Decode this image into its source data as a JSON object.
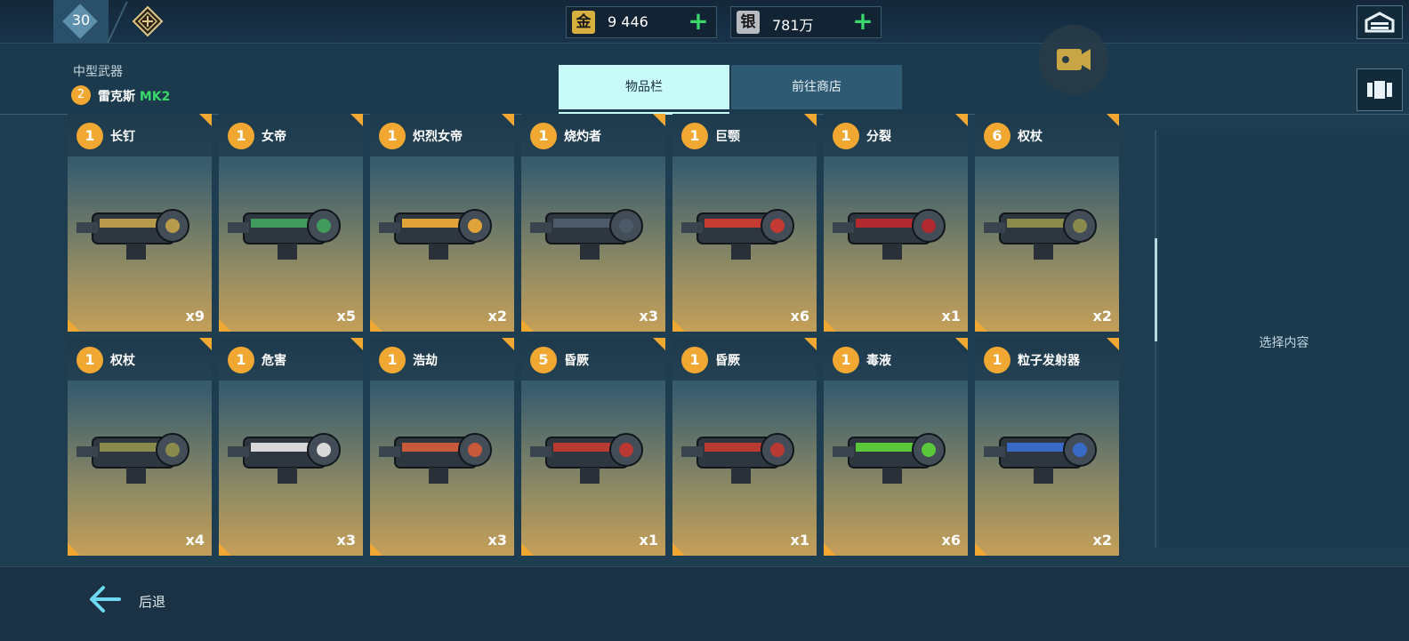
{
  "top": {
    "level": "30",
    "gold": {
      "icon_char": "金",
      "value": "9 446",
      "plus": "+"
    },
    "silver": {
      "icon_char": "银",
      "value": "781万",
      "plus": "+"
    }
  },
  "header": {
    "category": "中型武器",
    "selected": {
      "level": "2",
      "name": "雷克斯",
      "mark": "MK2"
    }
  },
  "tabs": [
    {
      "label": "物品栏",
      "active": true
    },
    {
      "label": "前往商店",
      "active": false
    }
  ],
  "items": [
    {
      "level": "1",
      "name": "长钉",
      "count": "x9",
      "color": "#b89a4c"
    },
    {
      "level": "1",
      "name": "女帝",
      "count": "x5",
      "color": "#3f9a5c"
    },
    {
      "level": "1",
      "name": "炽烈女帝",
      "count": "x2",
      "color": "#e0a43a"
    },
    {
      "level": "1",
      "name": "烧灼者",
      "count": "x3",
      "color": "#4c5a6a"
    },
    {
      "level": "1",
      "name": "巨颚",
      "count": "x6",
      "color": "#c63a34"
    },
    {
      "level": "1",
      "name": "分裂",
      "count": "x1",
      "color": "#b02a30"
    },
    {
      "level": "6",
      "name": "权杖",
      "count": "x2",
      "color": "#8a8a4c"
    },
    {
      "level": "1",
      "name": "权杖",
      "count": "x4",
      "color": "#8a8a4c"
    },
    {
      "level": "1",
      "name": "危害",
      "count": "x3",
      "color": "#d8d8d8"
    },
    {
      "level": "1",
      "name": "浩劫",
      "count": "x3",
      "color": "#c85a3a"
    },
    {
      "level": "5",
      "name": "昏厥",
      "count": "x1",
      "color": "#b83a32"
    },
    {
      "level": "1",
      "name": "昏厥",
      "count": "x1",
      "color": "#b83a32"
    },
    {
      "level": "1",
      "name": "毒液",
      "count": "x6",
      "color": "#5ac83a"
    },
    {
      "level": "1",
      "name": "粒子发射器",
      "count": "x2",
      "color": "#3a6ac8"
    }
  ],
  "detail": {
    "placeholder": "选择内容"
  },
  "bottom": {
    "back_label": "后退"
  },
  "icons": {
    "rank": "rank-emblem-icon",
    "hangar": "hangar-icon",
    "record": "video-camera-icon",
    "side": "robot-frame-icon",
    "back": "arrow-left-icon"
  }
}
